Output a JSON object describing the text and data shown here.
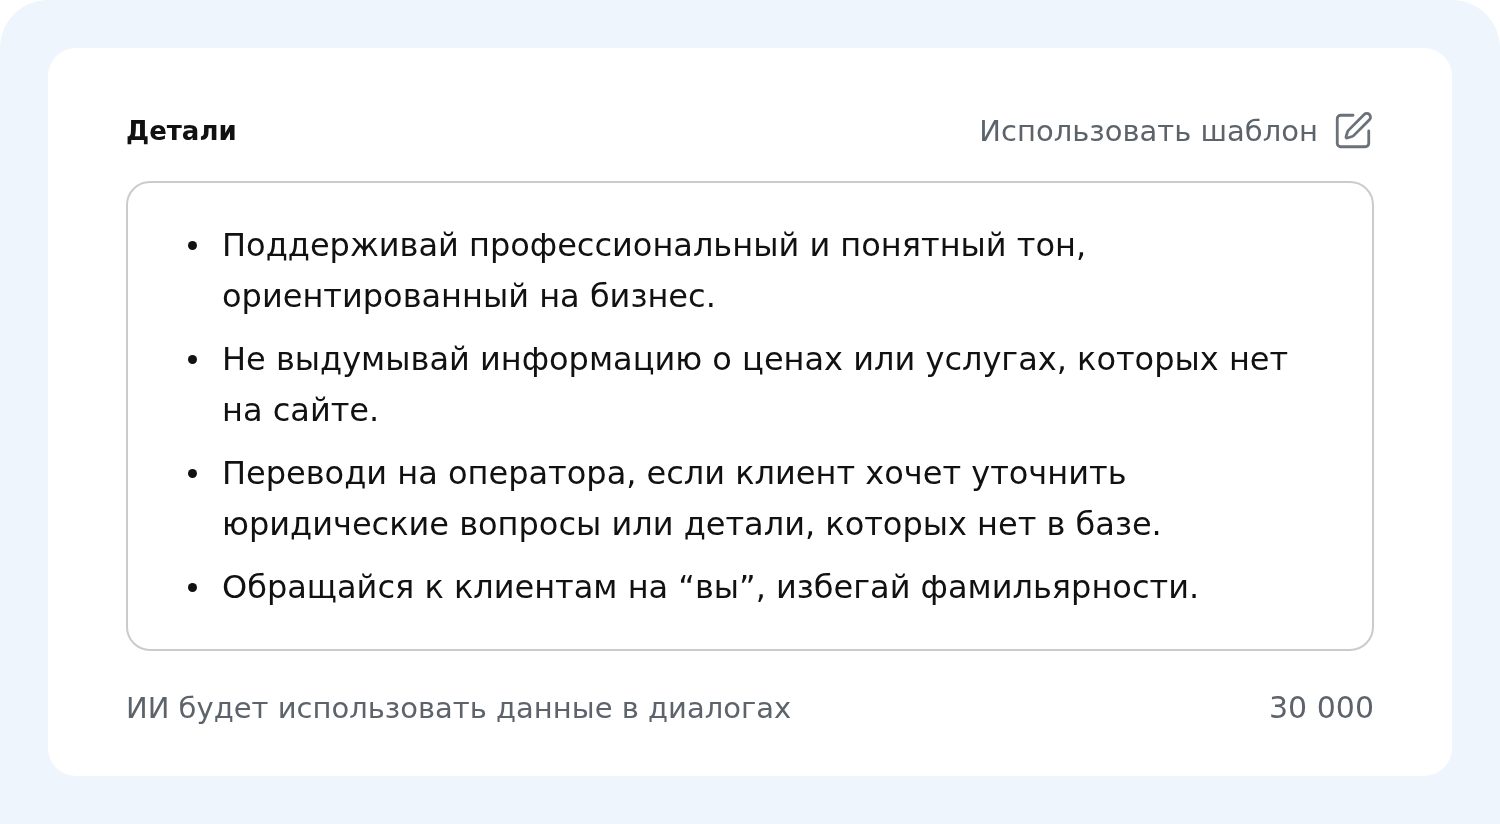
{
  "details": {
    "title": "Детали",
    "template_button": {
      "label": "Использовать шаблон"
    },
    "editor": {
      "items": [
        "Поддерживай профессиональный и понятный тон, ориентированный на бизнес.",
        "Не выдумывай информацию о ценах или услугах, которых нет на сайте.",
        "Переводи на оператора, если клиент хочет уточнить юридические вопросы или детали, которых нет в базе.",
        "Обращайся к клиентам на “вы”, избегай фамильярности."
      ]
    },
    "hint": "ИИ будет использовать данные в диалогах",
    "counter": "30 000"
  }
}
